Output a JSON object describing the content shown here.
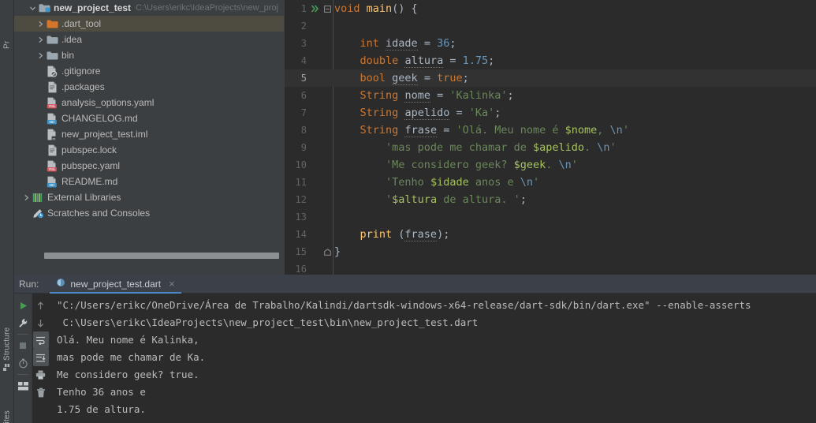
{
  "toolwindows": {
    "project_label": "Pr",
    "structure_label": "Structure",
    "favorites_label": "rites"
  },
  "project": {
    "root": {
      "name": "new_project_test",
      "path": "C:\\Users\\erikc\\IdeaProjects\\new_proj",
      "expanded": true
    },
    "items": [
      {
        "label": ".dart_tool",
        "icon": "folder-orange-icon",
        "arrow": true,
        "selected": true,
        "indent": 1
      },
      {
        "label": ".idea",
        "icon": "folder-icon",
        "arrow": true,
        "selected": false,
        "indent": 1
      },
      {
        "label": "bin",
        "icon": "folder-icon",
        "arrow": true,
        "selected": false,
        "indent": 1
      },
      {
        "label": ".gitignore",
        "icon": "gitignore-file-icon",
        "arrow": false,
        "selected": false,
        "indent": 1
      },
      {
        "label": ".packages",
        "icon": "text-file-icon",
        "arrow": false,
        "selected": false,
        "indent": 1
      },
      {
        "label": "analysis_options.yaml",
        "icon": "yaml-file-icon",
        "arrow": false,
        "selected": false,
        "indent": 1
      },
      {
        "label": "CHANGELOG.md",
        "icon": "markdown-file-icon",
        "arrow": false,
        "selected": false,
        "indent": 1
      },
      {
        "label": "new_project_test.iml",
        "icon": "iml-file-icon",
        "arrow": false,
        "selected": false,
        "indent": 1
      },
      {
        "label": "pubspec.lock",
        "icon": "text-file-icon",
        "arrow": false,
        "selected": false,
        "indent": 1
      },
      {
        "label": "pubspec.yaml",
        "icon": "yaml-file-icon",
        "arrow": false,
        "selected": false,
        "indent": 1
      },
      {
        "label": "README.md",
        "icon": "markdown-file-icon",
        "arrow": false,
        "selected": false,
        "indent": 1
      },
      {
        "label": "External Libraries",
        "icon": "libraries-icon",
        "arrow": true,
        "selected": false,
        "indent": 0
      },
      {
        "label": "Scratches and Consoles",
        "icon": "scratches-icon",
        "arrow": false,
        "selected": false,
        "indent": 0
      }
    ]
  },
  "editor": {
    "current_line": 5,
    "lines": [
      {
        "n": "1",
        "runmark": true,
        "fold": "open",
        "text": "void main() {"
      },
      {
        "n": "2",
        "runmark": false,
        "fold": "",
        "text": ""
      },
      {
        "n": "3",
        "runmark": false,
        "fold": "",
        "text": "    int idade = 36;"
      },
      {
        "n": "4",
        "runmark": false,
        "fold": "",
        "text": "    double altura = 1.75;"
      },
      {
        "n": "5",
        "runmark": false,
        "fold": "",
        "text": "    bool geek = true;"
      },
      {
        "n": "6",
        "runmark": false,
        "fold": "",
        "text": "    String nome = 'Kalinka';"
      },
      {
        "n": "7",
        "runmark": false,
        "fold": "",
        "text": "    String apelido = 'Ka';"
      },
      {
        "n": "8",
        "runmark": false,
        "fold": "",
        "text": "    String frase = 'Olá. Meu nome é $nome, \\n'"
      },
      {
        "n": "9",
        "runmark": false,
        "fold": "",
        "text": "        'mas pode me chamar de $apelido. \\n'"
      },
      {
        "n": "10",
        "runmark": false,
        "fold": "",
        "text": "        'Me considero geek? $geek. \\n'"
      },
      {
        "n": "11",
        "runmark": false,
        "fold": "",
        "text": "        'Tenho $idade anos e \\n'"
      },
      {
        "n": "12",
        "runmark": false,
        "fold": "",
        "text": "        '$altura de altura. ';"
      },
      {
        "n": "13",
        "runmark": false,
        "fold": "",
        "text": ""
      },
      {
        "n": "14",
        "runmark": false,
        "fold": "",
        "text": "    print (frase);"
      },
      {
        "n": "15",
        "runmark": false,
        "fold": "close",
        "text": "}"
      },
      {
        "n": "16",
        "runmark": false,
        "fold": "",
        "text": ""
      }
    ]
  },
  "run": {
    "run_label": "Run:",
    "tab_label": "new_project_test.dart",
    "tab_icon": "dart-file-icon",
    "close_glyph": "×",
    "left_buttons": [
      {
        "name": "rerun-button",
        "icon": "play-icon"
      },
      {
        "name": "settings-button",
        "icon": "wrench-icon"
      },
      {
        "name": "stop-button",
        "icon": "stop-icon"
      },
      {
        "name": "profile-button",
        "icon": "timer-icon"
      },
      {
        "name": "layout-button",
        "icon": "layout-icon"
      }
    ],
    "right_buttons": [
      {
        "name": "up-button",
        "icon": "arrow-up-icon",
        "active": false
      },
      {
        "name": "down-button",
        "icon": "arrow-down-icon",
        "active": false
      },
      {
        "name": "soft-wrap-button",
        "icon": "soft-wrap-icon",
        "active": true
      },
      {
        "name": "scroll-to-end-button",
        "icon": "scroll-end-icon",
        "active": true
      },
      {
        "name": "print-button",
        "icon": "printer-icon",
        "active": false
      },
      {
        "name": "clear-all-button",
        "icon": "trash-icon",
        "active": false
      }
    ],
    "console_lines": [
      "\"C:/Users/erikc/OneDrive/Área de Trabalho/Kalindi/dartsdk-windows-x64-release/dart-sdk/bin/dart.exe\" --enable-asserts",
      " C:\\Users\\erikc\\IdeaProjects\\new_project_test\\bin\\new_project_test.dart",
      "Olá. Meu nome é Kalinka,",
      "mas pode me chamar de Ka.",
      "Me considero geek? true.",
      "Tenho 36 anos e",
      "1.75 de altura."
    ]
  },
  "colors": {
    "panel_bg": "#3c3f41",
    "editor_bg": "#2b2b2b",
    "selection": "#4e4b41",
    "accent": "#4a88c7",
    "keyword": "#cc7832",
    "number": "#6897bb",
    "string": "#6a8759",
    "text": "#a9b7c6"
  }
}
